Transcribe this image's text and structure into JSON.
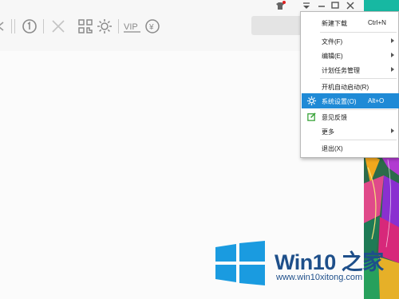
{
  "menu": {
    "items": [
      {
        "label": "新建下载",
        "shortcut": "Ctrl+N"
      },
      {
        "label": "文件(F)"
      },
      {
        "label": "编辑(E)"
      },
      {
        "label": "计划任务管理"
      },
      {
        "label": "开机自动启动(R)"
      },
      {
        "label": "系统设置(O)",
        "shortcut": "Alt+O"
      },
      {
        "label": "意见反馈"
      },
      {
        "label": "更多"
      },
      {
        "label": "退出(X)"
      }
    ]
  },
  "toolbar": {
    "icons": [
      "back-arrow-icon",
      "clock-1-icon",
      "clear-x-icon",
      "qrcode-icon",
      "settings-cog-icon",
      "vip-icon",
      "yen-icon"
    ],
    "vip_label": "VIP",
    "yen_label": "¥"
  },
  "window": {
    "controls": [
      "skin-icon",
      "menu-dropdown-icon",
      "minimize-icon",
      "maximize-icon",
      "close-icon"
    ]
  },
  "colors": {
    "menu_highlight": "#1f8ad6",
    "logo_blue": "#1e4f8a",
    "windows_blue": "#1a9be0"
  },
  "watermark": {
    "brand": "Win10 之家",
    "url": "www.win10xitong.com"
  }
}
